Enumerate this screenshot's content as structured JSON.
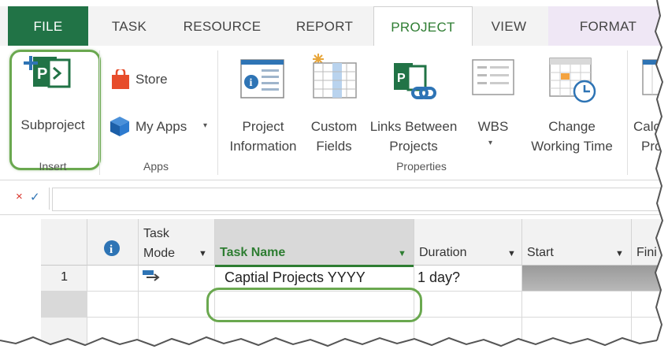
{
  "tabs": {
    "file": "FILE",
    "task": "TASK",
    "resource": "RESOURCE",
    "report": "REPORT",
    "project": "PROJECT",
    "view": "VIEW",
    "format": "FORMAT"
  },
  "ribbon": {
    "subproject": "Subproject",
    "insert_group": "Insert",
    "store": "Store",
    "my_apps": "My Apps",
    "apps_group": "Apps",
    "project_information": [
      "Project",
      "Information"
    ],
    "custom_fields": [
      "Custom",
      "Fields"
    ],
    "links_between_projects": [
      "Links Between",
      "Projects"
    ],
    "wbs": "WBS",
    "change_working_time": [
      "Change",
      "Working Time"
    ],
    "calculate_project": [
      "Calc",
      "Pro"
    ],
    "properties_group": "Properties"
  },
  "formula_bar": {
    "cancel_glyph": "×",
    "enter_glyph": "✓"
  },
  "grid": {
    "headers": {
      "task_mode": [
        "Task",
        "Mode"
      ],
      "task_name": "Task Name",
      "duration": "Duration",
      "start": "Start",
      "finish": "Fini"
    },
    "rows": [
      {
        "id": "1",
        "task_name": "Captial Projects YYYY",
        "duration": "1 day?"
      }
    ]
  },
  "colors": {
    "file_tab": "#217346",
    "accent_green": "#2e7d32",
    "highlight_ring": "#6aa84f",
    "project_icon": "#217346"
  }
}
